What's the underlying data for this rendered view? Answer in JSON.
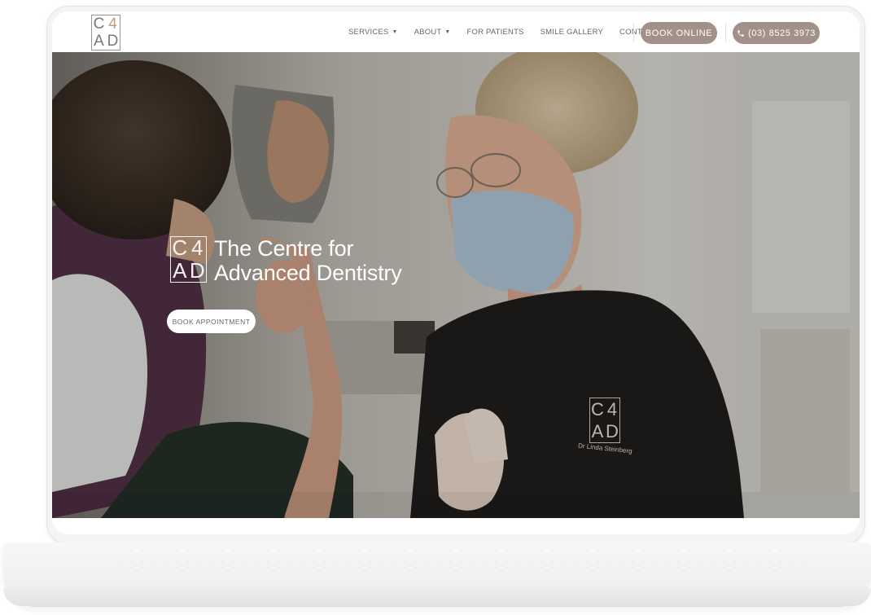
{
  "header": {
    "logo_letters": [
      "C",
      "4",
      "A",
      "D"
    ],
    "nav": [
      {
        "label": "SERVICES",
        "has_dropdown": true
      },
      {
        "label": "ABOUT",
        "has_dropdown": true
      },
      {
        "label": "FOR PATIENTS",
        "has_dropdown": false
      },
      {
        "label": "SMILE GALLERY",
        "has_dropdown": false
      },
      {
        "label": "CONTACT",
        "has_dropdown": false
      }
    ],
    "book_online_label": "BOOK ONLINE",
    "phone_label": "(03) 8525 3973",
    "phone_icon": "phone-icon"
  },
  "hero": {
    "logo_letters": [
      "C",
      "4",
      "A",
      "D"
    ],
    "title_line1": "The Centre for",
    "title_line2": "Advanced Dentistry",
    "cta_label": "BOOK APPOINTMENT",
    "scrub_logo_letters": [
      "C",
      "4",
      "A",
      "D"
    ],
    "scrub_name": "Dr Linda Steinberg"
  },
  "colors": {
    "accent_button": "#a19188",
    "nav_text": "#6b6561",
    "logo_accent": "#c59a7c"
  }
}
